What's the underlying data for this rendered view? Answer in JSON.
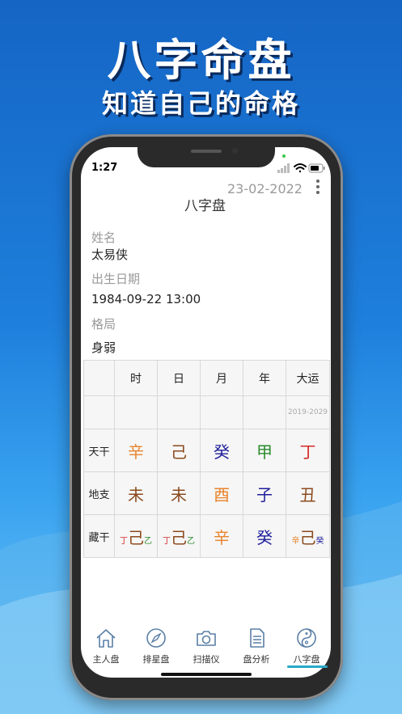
{
  "promo": {
    "headline": "八字命盘",
    "subheadline": "知道自己的命格"
  },
  "status_bar": {
    "time": "1:27"
  },
  "header": {
    "date": "23-02-2022",
    "title": "八字盘"
  },
  "profile": {
    "name_label": "姓名",
    "name_value": "太易侠",
    "birth_label": "出生日期",
    "birth_value": "1984-09-22 13:00",
    "pattern_label": "格局",
    "pattern_value": "身弱"
  },
  "table": {
    "headers": [
      "时",
      "日",
      "月",
      "年",
      "大运"
    ],
    "dayun_range": "2019-2029",
    "rows": [
      {
        "label": "天干",
        "cells": [
          {
            "text": "辛",
            "color": "#e8842c"
          },
          {
            "text": "己",
            "color": "#8b4a1e"
          },
          {
            "text": "癸",
            "color": "#1e1e9a"
          },
          {
            "text": "甲",
            "color": "#2a8a2a"
          },
          {
            "text": "丁",
            "color": "#d42a2a"
          }
        ]
      },
      {
        "label": "地支",
        "cells": [
          {
            "text": "未",
            "color": "#8b4a1e"
          },
          {
            "text": "未",
            "color": "#8b4a1e"
          },
          {
            "text": "酉",
            "color": "#e8842c"
          },
          {
            "text": "子",
            "color": "#1e1e9a"
          },
          {
            "text": "丑",
            "color": "#8b4a1e"
          }
        ]
      },
      {
        "label": "藏干",
        "cells": [
          [
            {
              "text": "丁",
              "color": "#d42a2a",
              "size": "small"
            },
            {
              "text": "己",
              "color": "#8b4a1e",
              "size": "big"
            },
            {
              "text": "乙",
              "color": "#2a8a2a",
              "size": "small"
            }
          ],
          [
            {
              "text": "丁",
              "color": "#d42a2a",
              "size": "small"
            },
            {
              "text": "己",
              "color": "#8b4a1e",
              "size": "big"
            },
            {
              "text": "乙",
              "color": "#2a8a2a",
              "size": "small"
            }
          ],
          [
            {
              "text": "辛",
              "color": "#e8842c",
              "size": "big"
            }
          ],
          [
            {
              "text": "癸",
              "color": "#1e1e9a",
              "size": "big"
            }
          ],
          [
            {
              "text": "辛",
              "color": "#e8842c",
              "size": "small"
            },
            {
              "text": "己",
              "color": "#8b4a1e",
              "size": "big"
            },
            {
              "text": "癸",
              "color": "#1e1e9a",
              "size": "small"
            }
          ]
        ]
      }
    ]
  },
  "tabs": [
    {
      "label": "主人盘",
      "icon": "house-icon"
    },
    {
      "label": "排星盘",
      "icon": "compass-icon"
    },
    {
      "label": "扫描仪",
      "icon": "camera-icon"
    },
    {
      "label": "盘分析",
      "icon": "document-icon"
    },
    {
      "label": "八字盘",
      "icon": "yin-yang-icon",
      "active": true
    }
  ],
  "colors": {
    "accent": "#2aa9c7",
    "background_top": "#1565c4",
    "background_bottom": "#79c8f5"
  }
}
